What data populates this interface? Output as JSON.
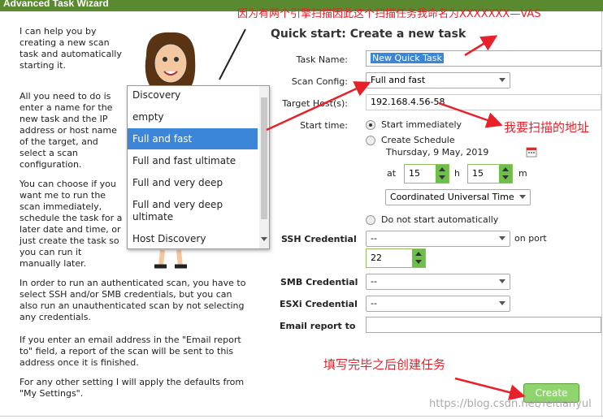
{
  "window": {
    "title": "Advanced Task Wizard"
  },
  "intro": {
    "p1": "I can help you by creating a new scan task and automatically starting it.",
    "p2": "All you need to do is enter a name for the new task and the IP address or host name of the target, and select a scan configuration.",
    "p3": "You can choose if you want me to run the scan immediately, schedule the task for a later date and time, or just create the task so you can run it manually later.",
    "p4": "In order to run an authenticated scan, you have to select SSH and/or SMB credentials, but you can also run an unauthenticated scan by not selecting any credentials.",
    "p5": "If you enter an email address in the \"Email report to\" field, a report of the scan will be sent to this address once it is finished.",
    "p6": "For any other setting I will apply the defaults from \"My Settings\"."
  },
  "form": {
    "heading": "Quick start: Create a new task",
    "task_name_label": "Task Name:",
    "task_name_value": "New Quick Task",
    "scan_config_label": "Scan Config:",
    "scan_config_value": "Full and fast",
    "target_label": "Target Host(s):",
    "target_value": "192.168.4.56-58",
    "start_time_label": "Start time:",
    "start_immediately": "Start immediately",
    "create_schedule": "Create Schedule",
    "schedule_date": "Thursday, 9 May, 2019",
    "at_label": "at",
    "hour_value": "15",
    "h_label": "h",
    "minute_value": "15",
    "m_label": "m",
    "timezone_value": "Coordinated Universal Time",
    "no_start": "Do not start automatically",
    "ssh_label": "SSH Credential",
    "ssh_value": "--",
    "on_port_label": "on port",
    "port_value": "22",
    "smb_label": "SMB Credential",
    "smb_value": "--",
    "esxi_label": "ESXi Credential",
    "esxi_value": "--",
    "email_label": "Email report to",
    "email_value": "",
    "create_button": "Create"
  },
  "dropdown": {
    "options": [
      "Discovery",
      "empty",
      "Full and fast",
      "Full and fast ultimate",
      "Full and very deep",
      "Full and very deep ultimate",
      "Host Discovery"
    ],
    "selected": "Full and fast"
  },
  "annotations": {
    "top": "因为有两个引擎扫描因此这个扫描任务我命名为XXXXXXX—VAS",
    "target": "我要扫描的地址",
    "create": "填写完毕之后创建任务"
  },
  "watermark": "https://blog.csdn.net/feitianyul",
  "colors": {
    "titlebar": "#5a8a2f",
    "accent": "#6cc04a",
    "annotation": "#e8202a",
    "selection": "#3b86d8"
  }
}
